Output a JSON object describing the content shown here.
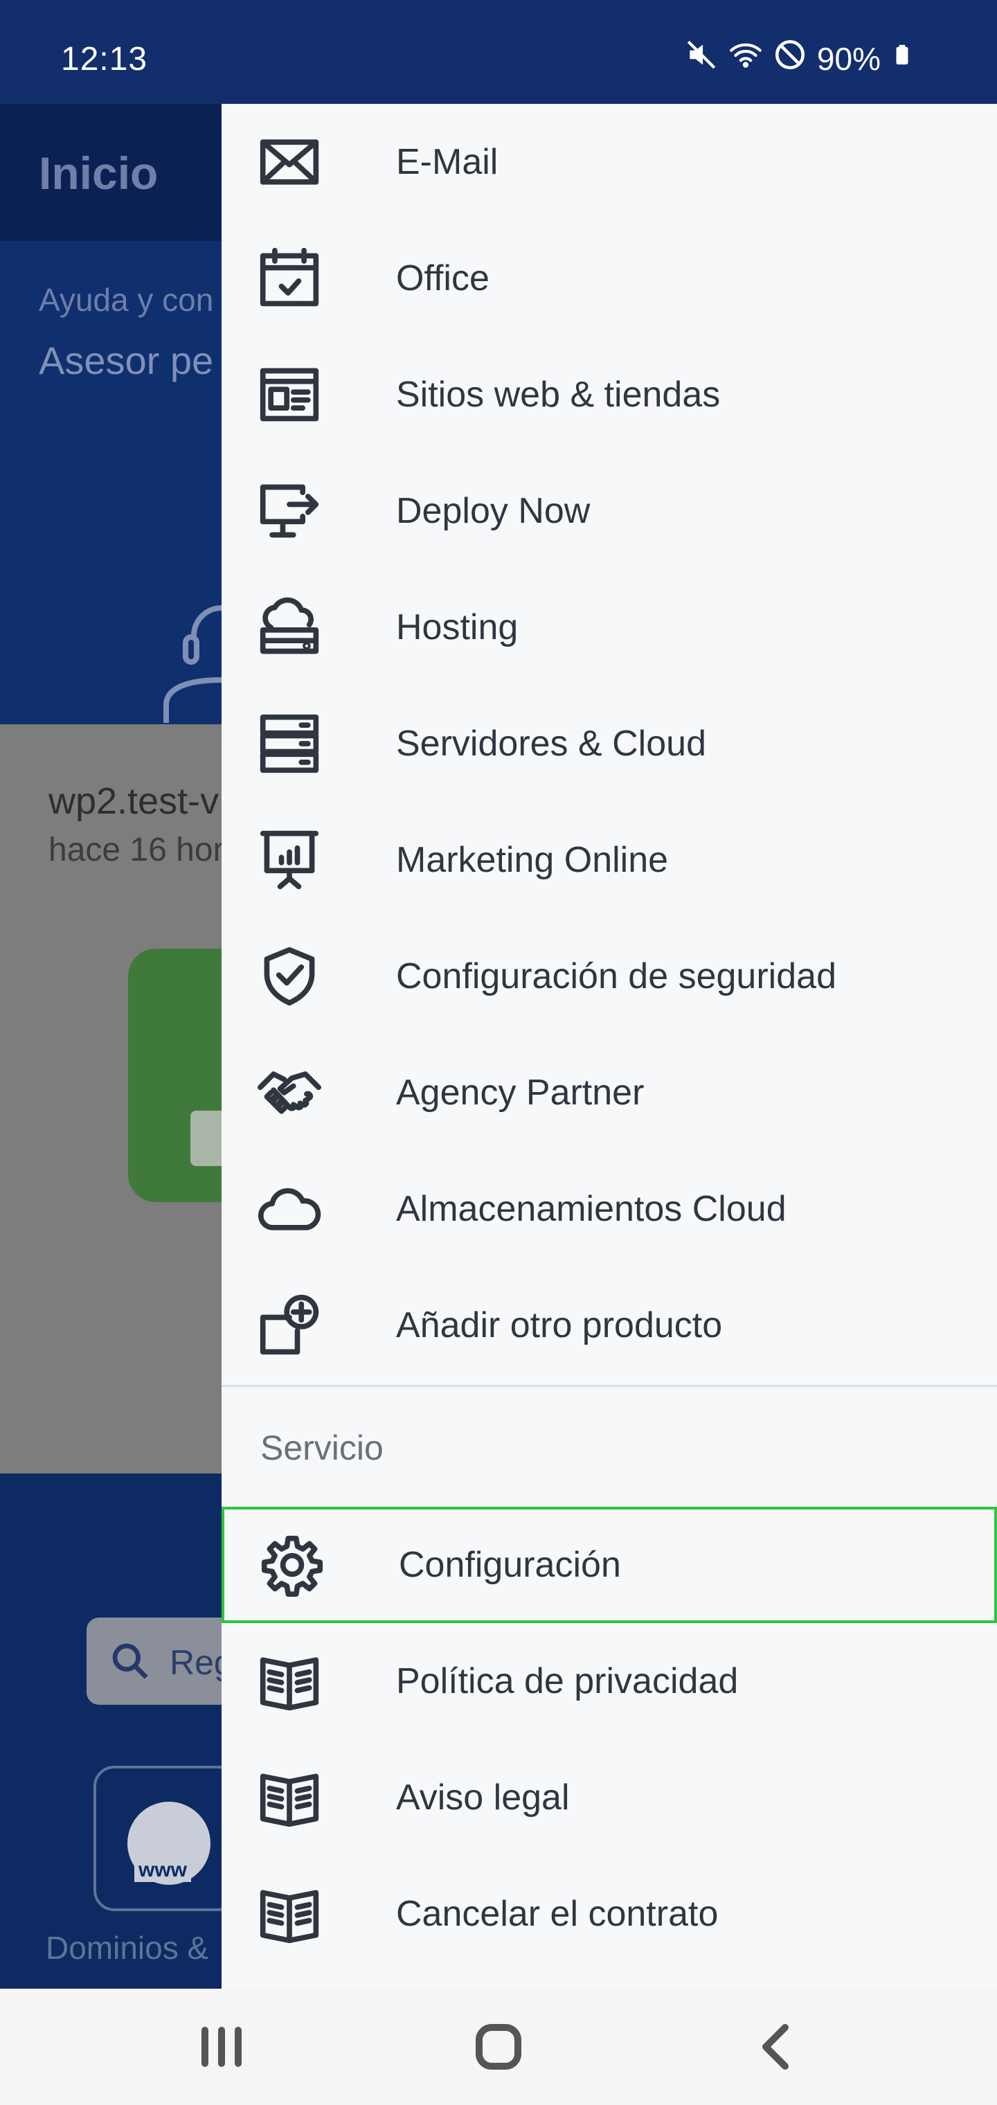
{
  "status_bar": {
    "time": "12:13",
    "battery": "90%",
    "icons": [
      "mute-icon",
      "wifi-icon",
      "do-not-disturb-icon",
      "battery-icon"
    ]
  },
  "background_app": {
    "header_title": "Inicio",
    "help_small": "Ayuda y con",
    "help_big": "Asesor pe",
    "site_domain": "wp2.test-v",
    "site_ago": "hace 16 hor",
    "search_placeholder": "Reg",
    "tile_label": "Dominios &",
    "tile_text": "www"
  },
  "drawer": {
    "products": [
      {
        "label": "E-Mail",
        "icon": "mail-icon"
      },
      {
        "label": "Office",
        "icon": "calendar-icon"
      },
      {
        "label": "Sitios web & tiendas",
        "icon": "website-icon"
      },
      {
        "label": "Deploy Now",
        "icon": "monitor-deploy-icon"
      },
      {
        "label": "Hosting",
        "icon": "cloud-server-icon"
      },
      {
        "label": "Servidores & Cloud",
        "icon": "server-rack-icon"
      },
      {
        "label": "Marketing Online",
        "icon": "presentation-icon"
      },
      {
        "label": "Configuración de seguridad",
        "icon": "shield-check-icon"
      },
      {
        "label": "Agency Partner",
        "icon": "handshake-icon"
      },
      {
        "label": "Almacenamientos Cloud",
        "icon": "cloud-icon"
      },
      {
        "label": "Añadir otro producto",
        "icon": "add-product-icon"
      }
    ],
    "service_header": "Servicio",
    "service": [
      {
        "label": "Configuración",
        "icon": "gear-icon"
      },
      {
        "label": "Política de privacidad",
        "icon": "book-icon"
      },
      {
        "label": "Aviso legal",
        "icon": "book-icon"
      },
      {
        "label": "Cancelar el contrato",
        "icon": "book-icon"
      }
    ],
    "selected_color": "#2cc73a"
  },
  "nav_bar": {
    "buttons": [
      "recent-apps-icon",
      "home-icon",
      "back-icon"
    ]
  }
}
